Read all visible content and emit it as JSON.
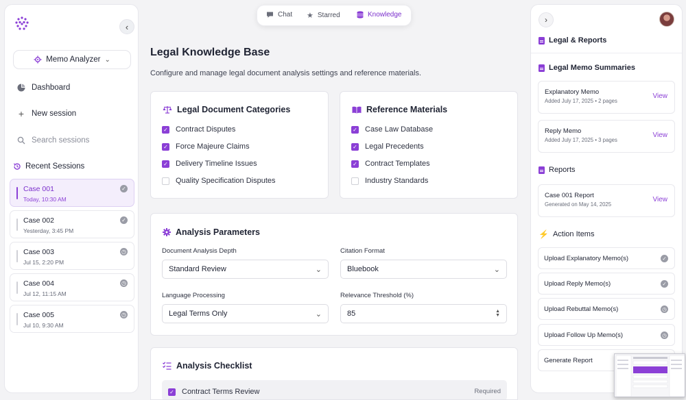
{
  "left": {
    "memo_selector": "Memo Analyzer",
    "nav": {
      "dashboard": "Dashboard",
      "new_session": "New session",
      "search_placeholder": "Search sessions"
    },
    "recent_title": "Recent Sessions",
    "sessions": [
      {
        "name": "Case 001",
        "time": "Today, 10:30 AM",
        "status": "completed",
        "active": true
      },
      {
        "name": "Case 002",
        "time": "Yesterday, 3:45 PM",
        "status": "completed"
      },
      {
        "name": "Case 003",
        "time": "Jul 15, 2:20 PM",
        "status": "pending"
      },
      {
        "name": "Case 004",
        "time": "Jul 12, 11:15 AM",
        "status": "pending"
      },
      {
        "name": "Case 005",
        "time": "Jul 10, 9:30 AM",
        "status": "pending"
      }
    ]
  },
  "tabs": {
    "chat": "Chat",
    "starred": "Starred",
    "knowledge": "Knowledge",
    "active": "Knowledge"
  },
  "main": {
    "title": "Legal Knowledge Base",
    "subtitle": "Configure and manage legal document analysis settings and reference materials.",
    "categories": {
      "title": "Legal Document Categories",
      "items": [
        {
          "label": "Contract Disputes",
          "checked": true
        },
        {
          "label": "Force Majeure Claims",
          "checked": true
        },
        {
          "label": "Delivery Timeline Issues",
          "checked": true
        },
        {
          "label": "Quality Specification Disputes",
          "checked": false
        }
      ]
    },
    "references": {
      "title": "Reference Materials",
      "items": [
        {
          "label": "Case Law Database",
          "checked": true
        },
        {
          "label": "Legal Precedents",
          "checked": true
        },
        {
          "label": "Contract Templates",
          "checked": true
        },
        {
          "label": "Industry Standards",
          "checked": false
        }
      ]
    },
    "params": {
      "title": "Analysis Parameters",
      "depth_label": "Document Analysis Depth",
      "depth_value": "Standard Review",
      "citation_label": "Citation Format",
      "citation_value": "Bluebook",
      "language_label": "Language Processing",
      "language_value": "Legal Terms Only",
      "threshold_label": "Relevance Threshold (%)",
      "threshold_value": "85"
    },
    "checklist": {
      "title": "Analysis Checklist",
      "first_item": "Contract Terms Review",
      "first_item_tag": "Required"
    }
  },
  "right": {
    "legal_reports": "Legal & Reports",
    "memo_summaries": "Legal Memo Summaries",
    "memos": [
      {
        "title": "Explanatory Memo",
        "meta": "Added July 17, 2025 • 2 pages",
        "action": "View"
      },
      {
        "title": "Reply Memo",
        "meta": "Added July 17, 2025 • 3 pages",
        "action": "View"
      }
    ],
    "reports_title": "Reports",
    "reports": [
      {
        "title": "Case 001 Report",
        "meta": "Generated on May 14, 2025",
        "action": "View"
      }
    ],
    "action_items_title": "Action Items",
    "actions": [
      {
        "label": "Upload Explanatory Memo(s)",
        "status": "completed"
      },
      {
        "label": "Upload Reply Memo(s)",
        "status": "completed"
      },
      {
        "label": "Upload Rebuttal Memo(s)",
        "status": "pending"
      },
      {
        "label": "Upload Follow Up Memo(s)",
        "status": "pending"
      },
      {
        "label": "Generate Report",
        "status": ""
      }
    ]
  },
  "colors": {
    "accent": "#8b3fd6",
    "accent_dark": "#7b2fcc",
    "status_gray": "#9a9ca6"
  },
  "icons": {
    "logo": "dot-grid-logo-icon",
    "completed": "check-circle-icon",
    "pending": "clock-icon"
  }
}
